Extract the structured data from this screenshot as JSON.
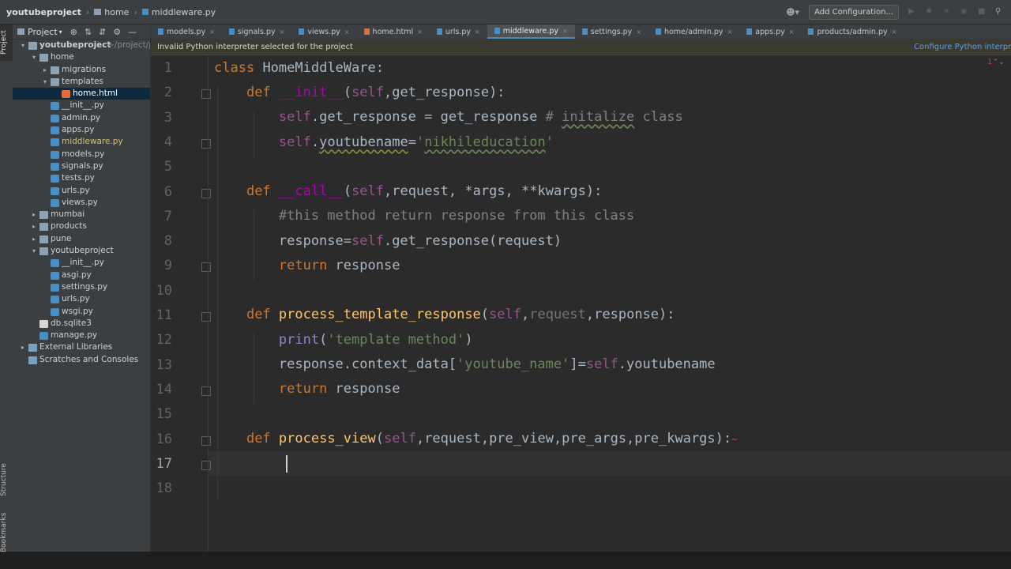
{
  "titlebar": {
    "project": "youtubeproject",
    "crumb2": "home",
    "crumb3": "middleware.py",
    "add_config": "Add Configuration..."
  },
  "toolstrip": {
    "project_tab": "Project",
    "structure_tab": "Structure",
    "bookmarks_tab": "Bookmarks"
  },
  "project_panel": {
    "header": "Project",
    "tree": [
      {
        "label": "youtubeproject",
        "extra": "~/project/py",
        "depth": 0,
        "type": "folder",
        "arrow": "open",
        "bold": true
      },
      {
        "label": "home",
        "depth": 1,
        "type": "folder",
        "arrow": "open"
      },
      {
        "label": "migrations",
        "depth": 2,
        "type": "folder",
        "arrow": "closed"
      },
      {
        "label": "templates",
        "depth": 2,
        "type": "folder",
        "arrow": "open"
      },
      {
        "label": "home.html",
        "depth": 3,
        "type": "html",
        "selected": true
      },
      {
        "label": "__init__.py",
        "depth": 2,
        "type": "py"
      },
      {
        "label": "admin.py",
        "depth": 2,
        "type": "py"
      },
      {
        "label": "apps.py",
        "depth": 2,
        "type": "py"
      },
      {
        "label": "middleware.py",
        "depth": 2,
        "type": "py",
        "modified": true
      },
      {
        "label": "models.py",
        "depth": 2,
        "type": "py"
      },
      {
        "label": "signals.py",
        "depth": 2,
        "type": "py"
      },
      {
        "label": "tests.py",
        "depth": 2,
        "type": "py"
      },
      {
        "label": "urls.py",
        "depth": 2,
        "type": "py"
      },
      {
        "label": "views.py",
        "depth": 2,
        "type": "py"
      },
      {
        "label": "mumbai",
        "depth": 1,
        "type": "folder",
        "arrow": "closed"
      },
      {
        "label": "products",
        "depth": 1,
        "type": "folder",
        "arrow": "closed"
      },
      {
        "label": "pune",
        "depth": 1,
        "type": "folder",
        "arrow": "closed"
      },
      {
        "label": "youtubeproject",
        "depth": 1,
        "type": "folder",
        "arrow": "open"
      },
      {
        "label": "__init__.py",
        "depth": 2,
        "type": "py"
      },
      {
        "label": "asgi.py",
        "depth": 2,
        "type": "py"
      },
      {
        "label": "settings.py",
        "depth": 2,
        "type": "py"
      },
      {
        "label": "urls.py",
        "depth": 2,
        "type": "py"
      },
      {
        "label": "wsgi.py",
        "depth": 2,
        "type": "py"
      },
      {
        "label": "db.sqlite3",
        "depth": 1,
        "type": "db"
      },
      {
        "label": "manage.py",
        "depth": 1,
        "type": "py"
      },
      {
        "label": "External Libraries",
        "depth": 0,
        "type": "lib",
        "arrow": "closed"
      },
      {
        "label": "Scratches and Consoles",
        "depth": 0,
        "type": "scratch"
      }
    ]
  },
  "tabs": [
    {
      "label": "models.py",
      "type": "py"
    },
    {
      "label": "signals.py",
      "type": "py"
    },
    {
      "label": "views.py",
      "type": "py"
    },
    {
      "label": "home.html",
      "type": "html"
    },
    {
      "label": "urls.py",
      "type": "py"
    },
    {
      "label": "middleware.py",
      "type": "py",
      "active": true
    },
    {
      "label": "settings.py",
      "type": "py"
    },
    {
      "label": "home/admin.py",
      "type": "py"
    },
    {
      "label": "apps.py",
      "type": "py"
    },
    {
      "label": "products/admin.py",
      "type": "py"
    }
  ],
  "banner": {
    "message": "Invalid Python interpreter selected for the project",
    "action": "Configure Python interpreter"
  },
  "editor": {
    "line_numbers": [
      "1",
      "2",
      "3",
      "4",
      "5",
      "6",
      "7",
      "8",
      "9",
      "10",
      "11",
      "12",
      "13",
      "14",
      "15",
      "16",
      "17",
      "18"
    ],
    "current_line": 17,
    "indicator": "1"
  },
  "colors": {
    "keyword": "#cc7832",
    "function": "#ffc66d",
    "magic": "#b200b2",
    "self": "#94558d",
    "string": "#6a8759",
    "comment": "#808080",
    "text": "#a9b7c6",
    "selection": "#0d293e",
    "link": "#589df6"
  }
}
